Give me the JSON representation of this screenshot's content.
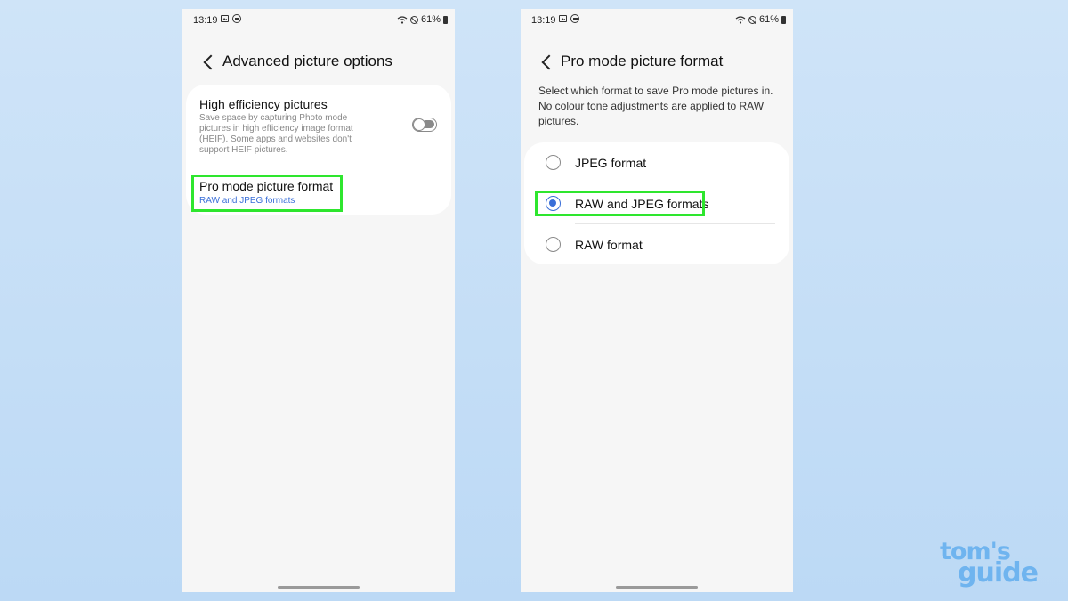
{
  "status_bar": {
    "time": "13:19",
    "battery": "61%",
    "icons": [
      "gallery-icon",
      "dnd-icon",
      "wifi-icon",
      "blocked-icon",
      "battery-icon"
    ]
  },
  "left_screen": {
    "title": "Advanced picture options",
    "settings": [
      {
        "title": "High efficiency pictures",
        "description": "Save space by capturing Photo mode pictures in high efficiency image format (HEIF). Some apps and websites don't support HEIF pictures.",
        "toggle": "off"
      },
      {
        "title": "Pro mode picture format",
        "value": "RAW and JPEG formats"
      }
    ]
  },
  "right_screen": {
    "title": "Pro mode picture format",
    "intro": "Select which format to save Pro mode pictures in. No colour tone adjustments are applied to RAW pictures.",
    "options": [
      {
        "label": "JPEG format",
        "selected": false
      },
      {
        "label": "RAW and JPEG formats",
        "selected": true
      },
      {
        "label": "RAW format",
        "selected": false
      }
    ]
  },
  "colors": {
    "accent": "#3a6fd8",
    "highlight": "#2ee62e",
    "background": "#bcd9f5"
  },
  "watermark": {
    "line1": "tom's",
    "line2": "guide"
  }
}
